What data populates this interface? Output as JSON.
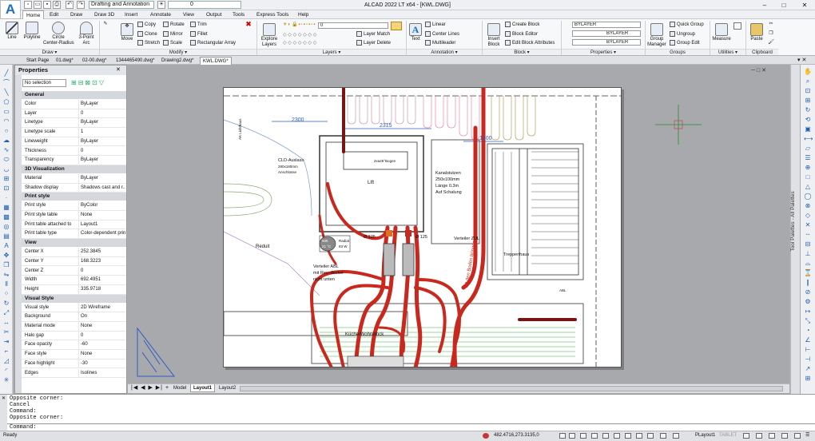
{
  "app": {
    "logo_letter": "A",
    "title": "ALCAD 2022 LT x64  -  [KWL.DWG]"
  },
  "quick_access": {
    "workspace": "Drafting and Annotation",
    "layer": "0"
  },
  "window_controls": {
    "minimize": "–",
    "maximize": "□",
    "close": "✕"
  },
  "menu_tabs": [
    "Home",
    "Edit",
    "Draw",
    "Draw 3D",
    "Insert",
    "Annotate",
    "View",
    "Output",
    "Tools",
    "Express Tools",
    "Help"
  ],
  "ribbon": {
    "draw": {
      "line": "Line",
      "polyline": "Polyline",
      "circle": "Circle\nCenter-Radius",
      "arc": "3-Point\nArc"
    },
    "modify": {
      "move": "Move",
      "copy": "Copy",
      "rotate": "Rotate",
      "trim": "Trim",
      "clone": "Clone",
      "mirror": "Mirror",
      "fillet": "Fillet",
      "stretch": "Stretch",
      "scale": "Scale",
      "rect_array": "Rectangular Array"
    },
    "layers": {
      "explore": "Explore\nLayers",
      "layer_value": "0",
      "layer_match": "Layer Match",
      "layer_delete": "Layer Delete"
    },
    "annotation": {
      "text": "Text",
      "linear": "Linear",
      "center_lines": "Center Lines",
      "multileader": "Multileader"
    },
    "block": {
      "insert": "Insert\nBlock",
      "create": "Create Block",
      "editor": "Block Editor",
      "edit_attributes": "Edit Block Attributes"
    },
    "properties": {
      "color": "BYLAYER",
      "linetype": "BYLAYER",
      "lineweight": "BYLAYER"
    },
    "groups": {
      "group_manager": "Group\nManager",
      "quick_group": "Quick Group",
      "ungroup": "Ungroup",
      "group_edit": "Group Edit"
    },
    "utilities": {
      "measure": "Measure"
    },
    "clipboard": {
      "paste": "Paste"
    },
    "group_labels": [
      "Draw ▾",
      "Modify ▾",
      "Layers ▾",
      "Annotation ▾",
      "Block ▾",
      "Properties ▾",
      "Groups",
      "Utilities ▾",
      "Clipboard"
    ]
  },
  "doc_tabs": [
    "Start Page",
    "01.dwg*",
    "02-00.dwg*",
    "1344465490.dwg*",
    "Drawing2.dwg*",
    "KWL.DWG*"
  ],
  "properties": {
    "title": "Properties",
    "selection": "No selection",
    "sections": [
      {
        "name": "General",
        "rows": [
          [
            "Color",
            "ByLayer"
          ],
          [
            "Layer",
            "0"
          ],
          [
            "Linetype",
            "ByLayer"
          ],
          [
            "Linetype scale",
            "1"
          ],
          [
            "Lineweight",
            "ByLayer"
          ],
          [
            "Thickness",
            "0"
          ],
          [
            "Transparency",
            "ByLayer"
          ]
        ]
      },
      {
        "name": "3D Visualization",
        "rows": [
          [
            "Material",
            "ByLayer"
          ],
          [
            "Shadow display",
            "Shadows cast and r..."
          ]
        ]
      },
      {
        "name": "Print style",
        "rows": [
          [
            "Print style",
            "ByColor"
          ],
          [
            "Print style table",
            "None"
          ],
          [
            "Print table attached to",
            "Layout1"
          ],
          [
            "Print table type",
            "Color-dependent prin..."
          ]
        ]
      },
      {
        "name": "View",
        "rows": [
          [
            "Center X",
            "252.3845"
          ],
          [
            "Center Y",
            "168.3223"
          ],
          [
            "Center Z",
            "0"
          ],
          [
            "Width",
            "692.4951"
          ],
          [
            "Height",
            "335.9718"
          ]
        ]
      },
      {
        "name": "Visual Style",
        "rows": [
          [
            "Visual style",
            "2D Wireframe"
          ],
          [
            "Background",
            "On"
          ],
          [
            "Material mode",
            "None"
          ],
          [
            "Halo gap",
            "0"
          ],
          [
            "Face opacity",
            "-60"
          ],
          [
            "Face style",
            "None"
          ],
          [
            "Face highlight",
            "-30"
          ],
          [
            "Edges",
            "Isolines"
          ]
        ]
      }
    ]
  },
  "drawing": {
    "dims": [
      "2300",
      "2315",
      "1600"
    ],
    "labels": [
      "CLD-Auslass",
      "280x180mm",
      "Anschlüsse",
      "Reduit",
      "Ø 125",
      "Ø 125",
      "Kanalstutzen",
      "250x100mm",
      "Länge  0.3m",
      "Auf Schalung",
      "2xa45°Bogen",
      "Lift",
      "Treppenhaus",
      "Alt den Boden bringen",
      "Verteiler ABL",
      "mit Rev.-deckel",
      "nicht unten",
      "Verteiler ZUL",
      "Küche/Wohnblock",
      "ABL",
      "605",
      "21 °C",
      "83 W",
      "Radiat",
      "AK Lichthaus"
    ]
  },
  "layout_tabs": [
    "Model",
    "Layout1",
    "Layout2"
  ],
  "tool_palette_label": "Tool Palettes - All Palettes",
  "command_lines": [
    "Opposite corner:",
    "Cancel",
    "Command:",
    "Opposite corner:"
  ],
  "command_prompt": "Command:",
  "status": {
    "ready": "Ready",
    "coords": "482.4716,273.3135,0",
    "layout": "PLayout1",
    "tablet": "TABLET"
  },
  "colors": {
    "accent": "#1d6fc3",
    "pipe_red": "#c8281e",
    "pipe_dark": "#7a1410"
  }
}
